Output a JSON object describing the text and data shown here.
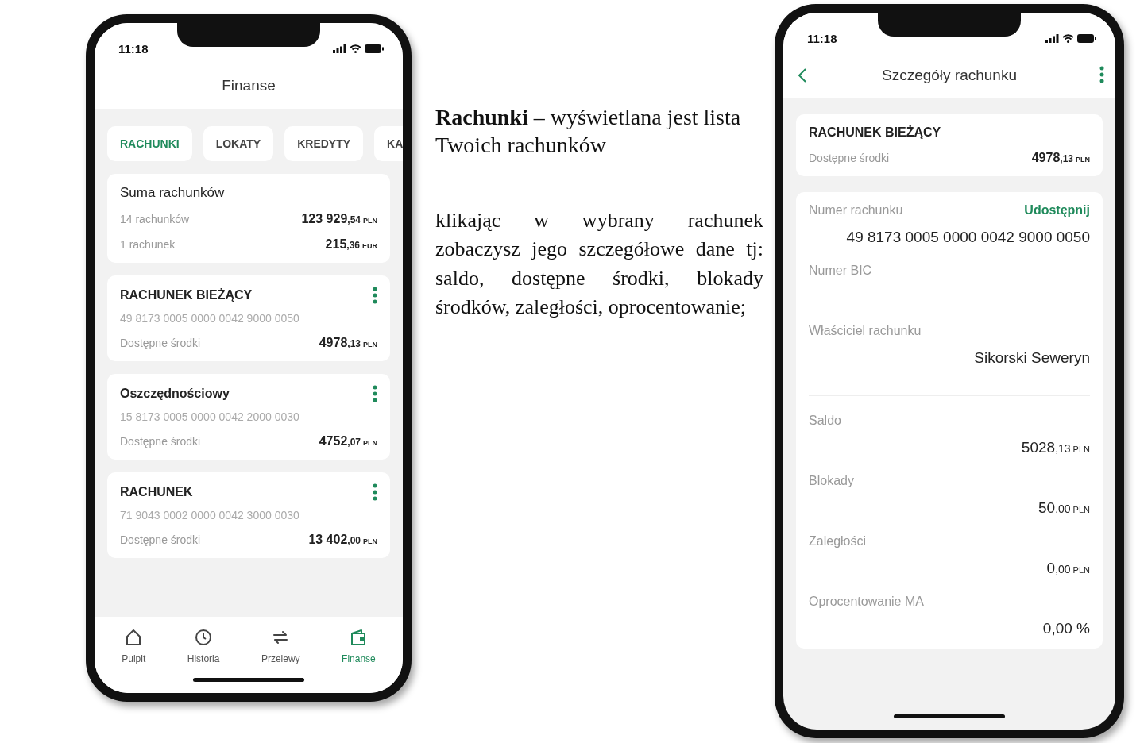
{
  "caption": "**Rachunki** – wyświetlana jest lista Twoich rachunków",
  "description": "klikając w wybrany rachunek zobaczysz jego szczegółowe dane tj: saldo, dostępne środki, blokady środków, zaległości, oprocentowanie;",
  "list_screen": {
    "time": "11:18",
    "title": "Finanse",
    "tabs": [
      {
        "label": "RACHUNKI",
        "selected": true
      },
      {
        "label": "LOKATY",
        "selected": false
      },
      {
        "label": "KREDYTY",
        "selected": false
      },
      {
        "label": "KA",
        "selected": false
      }
    ],
    "summary": {
      "title": "Suma rachunków",
      "rows": [
        {
          "label": "14 rachunków",
          "amount": "123 929",
          "decimals": ",54",
          "currency": "PLN"
        },
        {
          "label": "1 rachunek",
          "amount": "215",
          "decimals": ",36",
          "currency": "EUR"
        }
      ]
    },
    "accounts": [
      {
        "name": "RACHUNEK BIEŻĄCY",
        "number": "49 8173 0005 0000 0042 9000 0050",
        "label": "Dostępne środki",
        "amount": "4978",
        "decimals": ",13",
        "currency": "PLN"
      },
      {
        "name": "Oszczędnościowy",
        "number": "15 8173 0005 0000 0042 2000 0030",
        "label": "Dostępne środki",
        "amount": "4752",
        "decimals": ",07",
        "currency": "PLN"
      },
      {
        "name": "RACHUNEK",
        "number": "71 9043 0002 0000 0042 3000 0030",
        "label": "Dostępne środki",
        "amount": "13 402",
        "decimals": ",00",
        "currency": "PLN"
      }
    ],
    "nav": [
      {
        "label": "Pulpit",
        "selected": false
      },
      {
        "label": "Historia",
        "selected": false
      },
      {
        "label": "Przelewy",
        "selected": false
      },
      {
        "label": "Finanse",
        "selected": true
      }
    ]
  },
  "detail_screen": {
    "time": "11:18",
    "title": "Szczegóły rachunku",
    "account": {
      "name": "RACHUNEK BIEŻĄCY",
      "label": "Dostępne środki",
      "amount": "4978",
      "decimals": ",13",
      "currency": "PLN"
    },
    "info_fields": [
      {
        "label": "Numer rachunku",
        "action": "Udostępnij",
        "value": "49 8173 0005 0000 0042 9000 0050"
      },
      {
        "label": "Numer BIC"
      },
      {
        "label": "Właściciel rachunku",
        "value": "Sikorski Seweryn"
      }
    ],
    "balance_fields": [
      {
        "label": "Saldo",
        "amount": "5028",
        "decimals": ",13",
        "currency": "PLN"
      },
      {
        "label": "Blokady",
        "amount": "50",
        "decimals": ",00",
        "currency": "PLN"
      },
      {
        "label": "Zaległości",
        "amount": "0",
        "decimals": ",00",
        "currency": "PLN"
      },
      {
        "label": "Oprocentowanie MA",
        "value": "0,00 %"
      }
    ]
  }
}
